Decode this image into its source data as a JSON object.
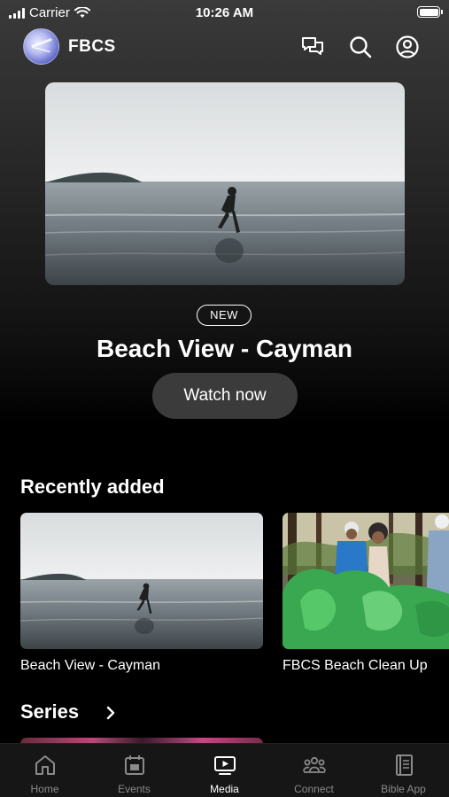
{
  "status_bar": {
    "carrier": "Carrier",
    "time": "10:26 AM"
  },
  "header": {
    "app_name": "FBCS",
    "icons": [
      "messages-icon",
      "search-icon",
      "account-icon"
    ]
  },
  "hero": {
    "badge": "NEW",
    "title": "Beach View - Cayman",
    "button_label": "Watch now"
  },
  "recently_added": {
    "title": "Recently added",
    "items": [
      {
        "label": "Beach View - Cayman"
      },
      {
        "label": "FBCS Beach Clean Up"
      }
    ]
  },
  "series": {
    "title": "Series"
  },
  "tabs": [
    {
      "label": "Home",
      "icon": "home-icon",
      "active": false
    },
    {
      "label": "Events",
      "icon": "calendar-icon",
      "active": false
    },
    {
      "label": "Media",
      "icon": "tv-play-icon",
      "active": true
    },
    {
      "label": "Connect",
      "icon": "people-icon",
      "active": false
    },
    {
      "label": "Bible App",
      "icon": "bible-icon",
      "active": false
    }
  ],
  "colors": {
    "background": "#000000",
    "button": "#3b3b3b",
    "tabbar": "#161616",
    "tab_inactive": "#8a8a8a"
  }
}
